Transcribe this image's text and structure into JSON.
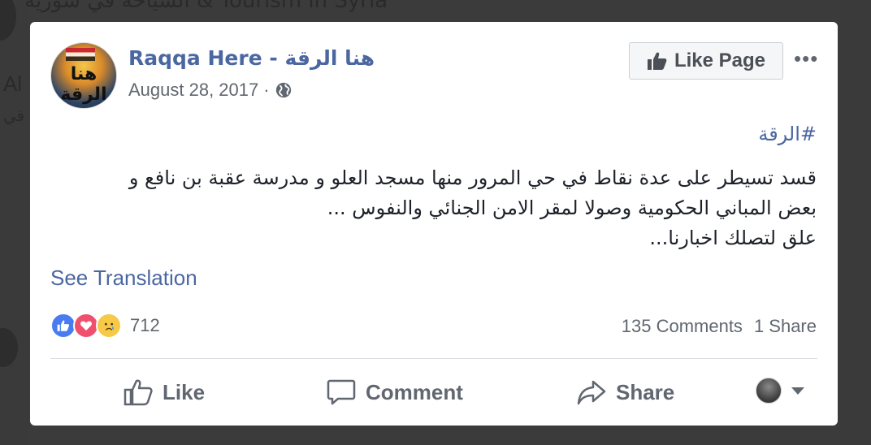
{
  "background": {
    "header_text": "السياحة في سورية & Tourism in Syria",
    "side_text_1": "Al",
    "side_text_2": "في"
  },
  "post": {
    "page_name": "Raqqa Here - هنا الرقة",
    "date": "August 28, 2017",
    "separator": "·",
    "avatar_text": "هنا الرقة",
    "like_page_label": "Like Page",
    "more_label": "•••",
    "hashtag": "#الرقة",
    "body_lines": [
      "قسد تسيطر على عدة نقاط في حي المرور منها مسجد العلو و مدرسة عقبة بن نافع و",
      "بعض المباني الحكومية وصولا لمقر الامن الجنائي والنفوس ...",
      "علق لتصلك اخبارنا..."
    ],
    "see_translation": "See Translation",
    "reaction_count": "712",
    "comments": "135 Comments",
    "shares": "1 Share",
    "actions": {
      "like": "Like",
      "comment": "Comment",
      "share": "Share"
    }
  },
  "colors": {
    "link": "#4b67a1",
    "secondary_text": "#616770",
    "like_reaction": "#4a7cf1",
    "love_reaction": "#f0506e",
    "sad_reaction": "#f7c948"
  }
}
